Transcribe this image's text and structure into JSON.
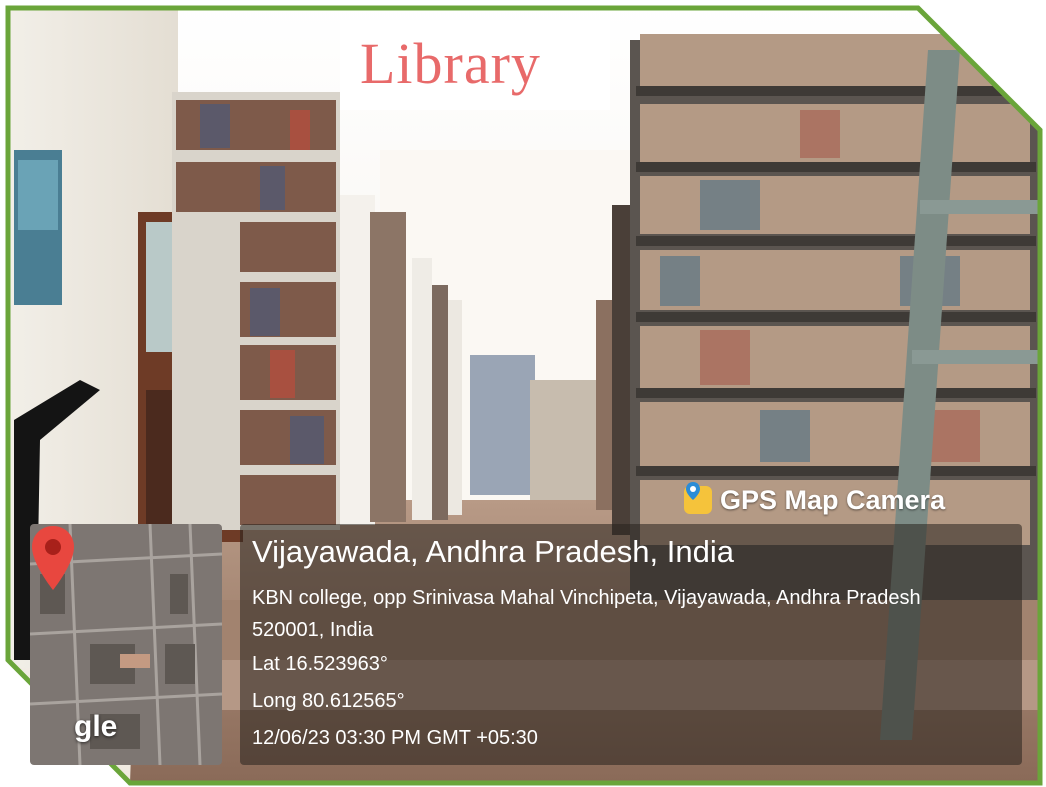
{
  "overlay_title": "Library",
  "gps": {
    "brand": "GPS Map Camera",
    "city": "Vijayawada, Andhra Pradesh, India",
    "address": "KBN college, opp Srinivasa Mahal Vinchipeta, Vijayawada, Andhra Pradesh 520001, India",
    "lat": "Lat 16.523963°",
    "long": "Long 80.612565°",
    "datetime": "12/06/23 03:30 PM GMT +05:30",
    "map_logo": "gle"
  },
  "colors": {
    "frame_border": "#6aa53a",
    "title": "#e86a6a",
    "pin": "#e8473f"
  },
  "icons": [
    "map-pin-icon",
    "gps-camera-icon"
  ]
}
